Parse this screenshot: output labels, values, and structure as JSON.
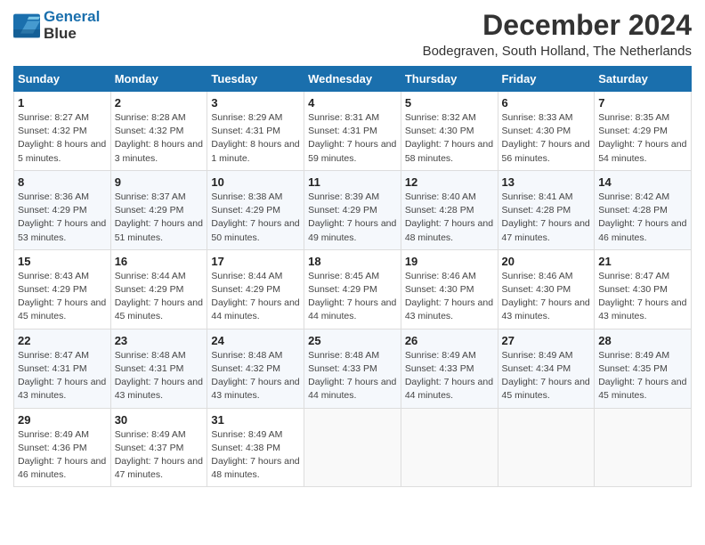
{
  "logo": {
    "line1": "General",
    "line2": "Blue"
  },
  "title": "December 2024",
  "subtitle": "Bodegraven, South Holland, The Netherlands",
  "days_of_week": [
    "Sunday",
    "Monday",
    "Tuesday",
    "Wednesday",
    "Thursday",
    "Friday",
    "Saturday"
  ],
  "weeks": [
    [
      {
        "day": 1,
        "sunrise": "8:27 AM",
        "sunset": "4:32 PM",
        "daylight": "8 hours and 5 minutes."
      },
      {
        "day": 2,
        "sunrise": "8:28 AM",
        "sunset": "4:32 PM",
        "daylight": "8 hours and 3 minutes."
      },
      {
        "day": 3,
        "sunrise": "8:29 AM",
        "sunset": "4:31 PM",
        "daylight": "8 hours and 1 minute."
      },
      {
        "day": 4,
        "sunrise": "8:31 AM",
        "sunset": "4:31 PM",
        "daylight": "7 hours and 59 minutes."
      },
      {
        "day": 5,
        "sunrise": "8:32 AM",
        "sunset": "4:30 PM",
        "daylight": "7 hours and 58 minutes."
      },
      {
        "day": 6,
        "sunrise": "8:33 AM",
        "sunset": "4:30 PM",
        "daylight": "7 hours and 56 minutes."
      },
      {
        "day": 7,
        "sunrise": "8:35 AM",
        "sunset": "4:29 PM",
        "daylight": "7 hours and 54 minutes."
      }
    ],
    [
      {
        "day": 8,
        "sunrise": "8:36 AM",
        "sunset": "4:29 PM",
        "daylight": "7 hours and 53 minutes."
      },
      {
        "day": 9,
        "sunrise": "8:37 AM",
        "sunset": "4:29 PM",
        "daylight": "7 hours and 51 minutes."
      },
      {
        "day": 10,
        "sunrise": "8:38 AM",
        "sunset": "4:29 PM",
        "daylight": "7 hours and 50 minutes."
      },
      {
        "day": 11,
        "sunrise": "8:39 AM",
        "sunset": "4:29 PM",
        "daylight": "7 hours and 49 minutes."
      },
      {
        "day": 12,
        "sunrise": "8:40 AM",
        "sunset": "4:28 PM",
        "daylight": "7 hours and 48 minutes."
      },
      {
        "day": 13,
        "sunrise": "8:41 AM",
        "sunset": "4:28 PM",
        "daylight": "7 hours and 47 minutes."
      },
      {
        "day": 14,
        "sunrise": "8:42 AM",
        "sunset": "4:28 PM",
        "daylight": "7 hours and 46 minutes."
      }
    ],
    [
      {
        "day": 15,
        "sunrise": "8:43 AM",
        "sunset": "4:29 PM",
        "daylight": "7 hours and 45 minutes."
      },
      {
        "day": 16,
        "sunrise": "8:44 AM",
        "sunset": "4:29 PM",
        "daylight": "7 hours and 45 minutes."
      },
      {
        "day": 17,
        "sunrise": "8:44 AM",
        "sunset": "4:29 PM",
        "daylight": "7 hours and 44 minutes."
      },
      {
        "day": 18,
        "sunrise": "8:45 AM",
        "sunset": "4:29 PM",
        "daylight": "7 hours and 44 minutes."
      },
      {
        "day": 19,
        "sunrise": "8:46 AM",
        "sunset": "4:30 PM",
        "daylight": "7 hours and 43 minutes."
      },
      {
        "day": 20,
        "sunrise": "8:46 AM",
        "sunset": "4:30 PM",
        "daylight": "7 hours and 43 minutes."
      },
      {
        "day": 21,
        "sunrise": "8:47 AM",
        "sunset": "4:30 PM",
        "daylight": "7 hours and 43 minutes."
      }
    ],
    [
      {
        "day": 22,
        "sunrise": "8:47 AM",
        "sunset": "4:31 PM",
        "daylight": "7 hours and 43 minutes."
      },
      {
        "day": 23,
        "sunrise": "8:48 AM",
        "sunset": "4:31 PM",
        "daylight": "7 hours and 43 minutes."
      },
      {
        "day": 24,
        "sunrise": "8:48 AM",
        "sunset": "4:32 PM",
        "daylight": "7 hours and 43 minutes."
      },
      {
        "day": 25,
        "sunrise": "8:48 AM",
        "sunset": "4:33 PM",
        "daylight": "7 hours and 44 minutes."
      },
      {
        "day": 26,
        "sunrise": "8:49 AM",
        "sunset": "4:33 PM",
        "daylight": "7 hours and 44 minutes."
      },
      {
        "day": 27,
        "sunrise": "8:49 AM",
        "sunset": "4:34 PM",
        "daylight": "7 hours and 45 minutes."
      },
      {
        "day": 28,
        "sunrise": "8:49 AM",
        "sunset": "4:35 PM",
        "daylight": "7 hours and 45 minutes."
      }
    ],
    [
      {
        "day": 29,
        "sunrise": "8:49 AM",
        "sunset": "4:36 PM",
        "daylight": "7 hours and 46 minutes."
      },
      {
        "day": 30,
        "sunrise": "8:49 AM",
        "sunset": "4:37 PM",
        "daylight": "7 hours and 47 minutes."
      },
      {
        "day": 31,
        "sunrise": "8:49 AM",
        "sunset": "4:38 PM",
        "daylight": "7 hours and 48 minutes."
      },
      null,
      null,
      null,
      null
    ]
  ],
  "labels": {
    "sunrise": "Sunrise:",
    "sunset": "Sunset:",
    "daylight": "Daylight:"
  }
}
